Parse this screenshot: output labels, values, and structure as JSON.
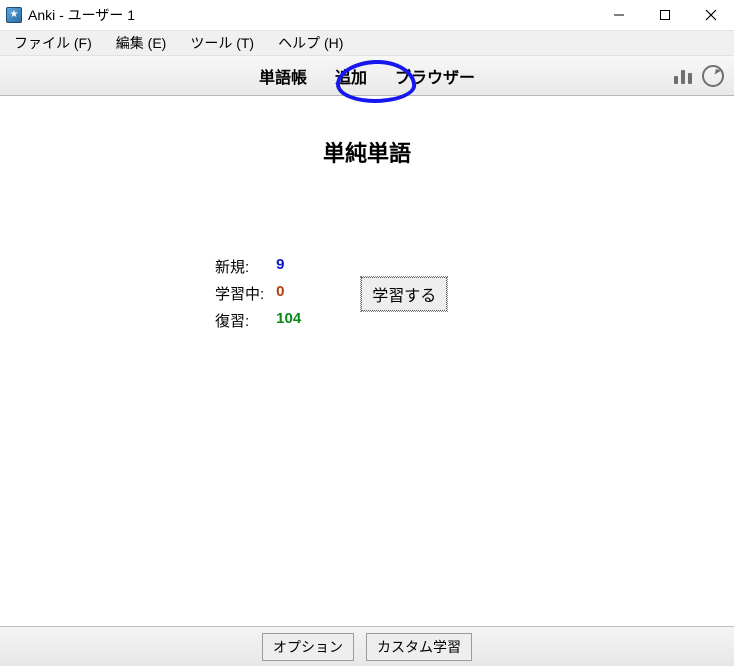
{
  "window": {
    "title": "Anki - ユーザー 1"
  },
  "menu": {
    "file": "ファイル (F)",
    "edit": "編集 (E)",
    "tools": "ツール (T)",
    "help": "ヘルプ (H)"
  },
  "tabs": {
    "decks": "単語帳",
    "add": "追加",
    "browse": "ブラウザー"
  },
  "icons": {
    "stats": "stats-bars-icon",
    "sync": "sync-icon"
  },
  "deck": {
    "name": "単純単語",
    "labels": {
      "new": "新規:",
      "learn": "学習中:",
      "review": "復習:"
    },
    "counts": {
      "new": "9",
      "learn": "0",
      "review": "104"
    },
    "study_button": "学習する"
  },
  "bottom": {
    "options": "オプション",
    "custom_study": "カスタム学習"
  },
  "annotation": {
    "highlighted_tab": "add",
    "stroke_color": "#1616ee"
  }
}
